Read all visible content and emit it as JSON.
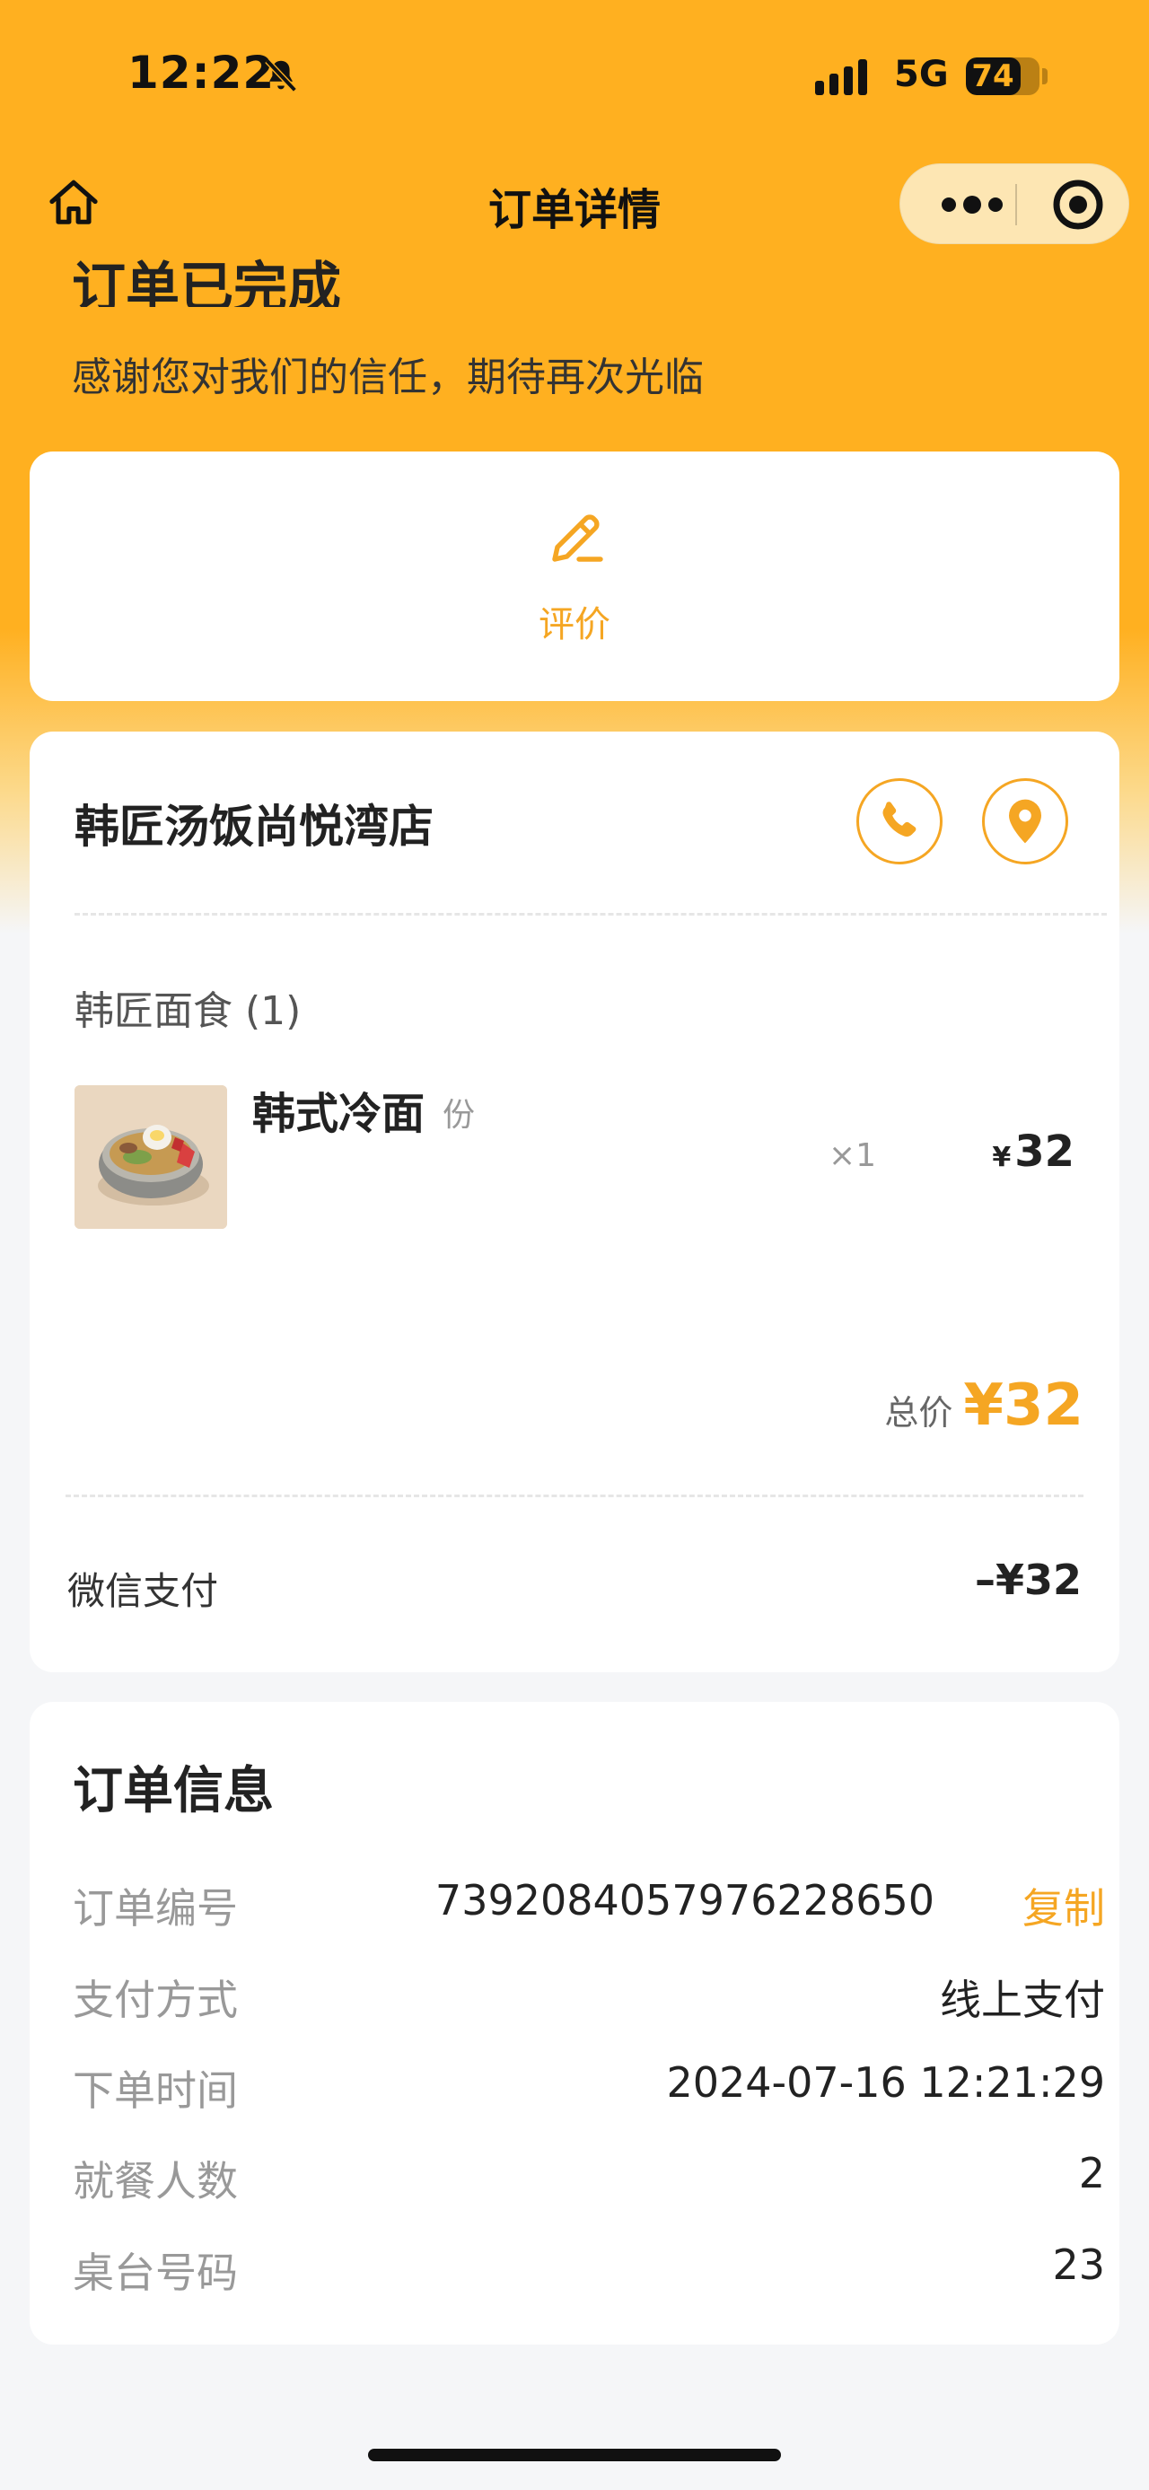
{
  "status_bar": {
    "time": "12:22",
    "network": "5G",
    "battery": "74",
    "battery_level": 0.74
  },
  "nav": {
    "title": "订单详情"
  },
  "order_status": {
    "title": "订单已完成",
    "subtitle": "感谢您对我们的信任，期待再次光临"
  },
  "review": {
    "label": "评价"
  },
  "order": {
    "shop_name": "韩匠汤饭尚悦湾店",
    "category": "韩匠面食 (1)",
    "items": [
      {
        "name": "韩式冷面",
        "unit": "份",
        "qty": "×1",
        "currency": "¥",
        "price": "32"
      }
    ],
    "total_label": "总价",
    "total_value": "¥32",
    "payment_method": "微信支付",
    "payment_amount": "–¥32"
  },
  "info": {
    "title": "订单信息",
    "copy_label": "复制",
    "rows": [
      {
        "label": "订单编号",
        "value": "7392084057976228650"
      },
      {
        "label": "支付方式",
        "value": "线上支付"
      },
      {
        "label": "下单时间",
        "value": "2024-07-16 12:21:29"
      },
      {
        "label": "就餐人数",
        "value": "2"
      },
      {
        "label": "桌台号码",
        "value": "23"
      }
    ]
  },
  "colors": {
    "accent": "#f5a623",
    "header": "#ffb020"
  }
}
